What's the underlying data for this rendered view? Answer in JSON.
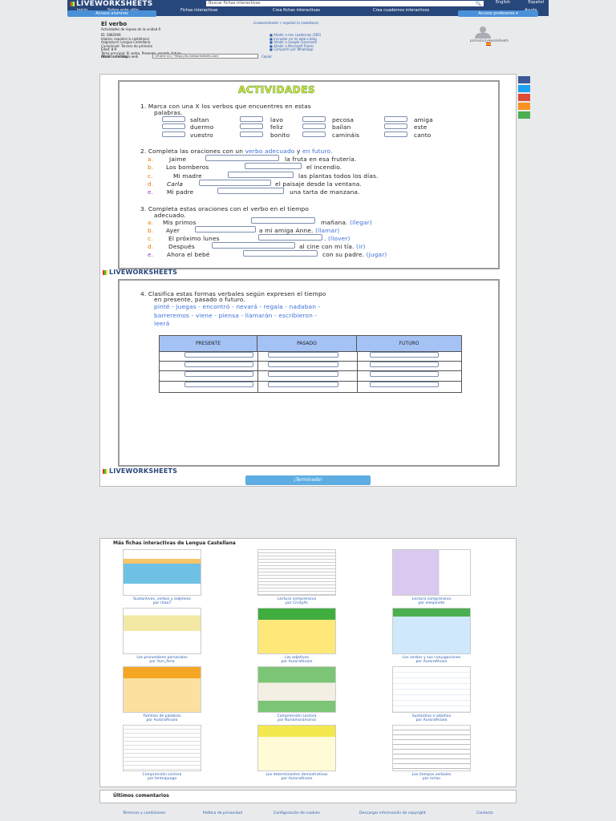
{
  "header": {
    "logo": "LIVEWORKSHEETS",
    "search_placeholder": "Buscar fichas interactivas",
    "search_button": "Búsqueda avanzada",
    "lang": "English",
    "lang2": "Español",
    "menu": [
      "Inicio",
      "Sobre este sitio",
      "Fichas interactivas",
      "Crea fichas interactivas",
      "Crea cuadernos interactivos",
      "Ayuda"
    ],
    "access_students": "Acceso alumnos",
    "access_teachers": "Acceso profesores"
  },
  "meta": {
    "title": "El verbo",
    "subtitle": "Actividades de repaso de la unidad 9",
    "lines": [
      "ID: 2882006",
      "Idioma: español (o castellano)",
      "Asignatura: Lengua Castellana",
      "Curso/nivel: Tercero de primaria",
      "Edad: 8-9",
      "Tema principal: El verbo, Presente, pasado, futuro",
      "Otros contenidos:"
    ],
    "embed_label": "Añadir a mi blog o web",
    "embed_code": "<iframe src=\"https://es.liveworksheets.com/",
    "embed_btn": "Copiar"
  },
  "breadcrumb": "Liveworksheets > español (o castellano)",
  "share": [
    "Añadir a mis cuadernos (265)",
    "Incrustar en mi web o blog",
    "Añadir a Google Classroom",
    "Añadir a Microsoft Teams",
    "Compartir por Whatsapp"
  ],
  "avatar_label": "primaria.liveworksheets",
  "activities": {
    "title": "ACTIVIDADES",
    "q1": "1.    Marca con una  X  los verbos que encuentres en estas",
    "q1b": "palabras.",
    "words": [
      "saltan",
      "lavo",
      "pecosa",
      "amiga",
      "duermo",
      "feliz",
      "bailan",
      "este",
      "vuestro",
      "bonito",
      "camináis",
      "canto"
    ],
    "q2a": "2.   Completa las oraciones con un ",
    "q2b": "verbo adecuado",
    "q2c": " y ",
    "q2d": "en futuro.",
    "q2": [
      [
        "a.",
        "Jaime",
        "la fruta en esa frutería."
      ],
      [
        "b.",
        "Los bomberos",
        "el incendio."
      ],
      [
        "c.",
        "Mi madre",
        "las plantas todos los días."
      ],
      [
        "d.",
        "Carla",
        "el paisaje desde la ventana."
      ],
      [
        "e.",
        "Mi padre",
        "una tarta de manzana."
      ]
    ],
    "q3": "3.    Completa estas oraciones con el verbo en el tiempo",
    "q3b": "adecuado.",
    "q3items": [
      [
        "a.",
        "Mis primos",
        "mañana.",
        "(llegar)"
      ],
      [
        "b.",
        "Ayer",
        "a mi amiga Anne.",
        "(llamar)"
      ],
      [
        "c.",
        "El próximo lunes",
        ".",
        "(llover)"
      ],
      [
        "d.",
        "Después",
        "al cine con mi tía.",
        "(ir)"
      ],
      [
        "e.",
        "Ahora el bebé",
        "con su padre.",
        "(jugar)"
      ]
    ],
    "q4": "4.   Clasifica estas formas verbales según expresen el tiempo",
    "q4b": "en presente, pasado o futuro.",
    "verbs1": "pinté - juegas - encontró - nevará - regala - nadaban -",
    "verbs2": "barreremos - viene - piensa - llamarán - escribieron -",
    "verbs3": "leerá",
    "cols": [
      "PRESENTE",
      "PASADO",
      "FUTURO"
    ],
    "finish": "¡Terminado!"
  },
  "watermark": "LIVEWORKSHEETS",
  "more": {
    "title": "Más fichas interactivas de Lengua Castellana",
    "items": [
      [
        "Sustantivos, verbos y adjetivos",
        "por ritaa7"
      ],
      [
        "Lectura comprensiva",
        "por CristyAc"
      ],
      [
        "Lectura comprensiva",
        "por elespinete"
      ],
      [
        "Los pronombres personales",
        "por Yuni_Ama"
      ],
      [
        "Los adjetivos",
        "por AuroraAlvaro"
      ],
      [
        "Los verbos y sus conjugaciones",
        "por AuroraAlvaro"
      ],
      [
        "Familias de palabras",
        "por AuroraAlvaro"
      ],
      [
        "Comprensión Lectora",
        "por Nuriamoramarco"
      ],
      [
        "Sustantivo o adjetivo",
        "por AuroraAlvaro"
      ],
      [
        "Comprensión Lectora",
        "por lenteajuego"
      ],
      [
        "Los determinantes demostrativos",
        "por AuroraAlvaro"
      ],
      [
        "Los tiempos verbales",
        "por mrlou"
      ]
    ]
  },
  "latest": "Últimos comentarios",
  "footer": [
    "Términos y condiciones",
    "Política de privacidad",
    "Configuración de cookies",
    "Descargar información de copyright",
    "Contacto"
  ]
}
